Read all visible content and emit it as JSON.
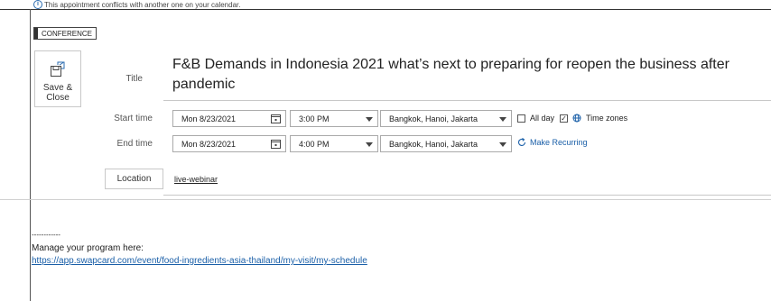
{
  "notice": {
    "text": "This appointment conflicts with another one on your calendar."
  },
  "category": {
    "label": "CONFERENCE"
  },
  "save_close": {
    "label": "Save &\nClose"
  },
  "labels": {
    "title": "Title",
    "start_time": "Start time",
    "end_time": "End time"
  },
  "title": {
    "value": "F&B Demands in Indonesia 2021 what’s next to preparing for reopen the business after pandemic"
  },
  "start": {
    "date": "Mon 8/23/2021",
    "time": "3:00 PM",
    "timezone": "Bangkok, Hanoi, Jakarta"
  },
  "end": {
    "date": "Mon 8/23/2021",
    "time": "4:00 PM",
    "timezone": "Bangkok, Hanoi, Jakarta"
  },
  "options": {
    "all_day": "All day",
    "all_day_checked": false,
    "time_zones": "Time zones",
    "time_zones_checked": true,
    "make_recurring": "Make Recurring"
  },
  "location": {
    "button_label": "Location",
    "value": "live-webinar"
  },
  "body": {
    "dashes": "------------",
    "manage_text": "Manage your program here:",
    "link": "https://app.swapcard.com/event/food-ingredients-asia-thailand/my-visit/my-schedule"
  },
  "colors": {
    "accent": "#1a5fa8",
    "border": "#c8c8c8"
  }
}
